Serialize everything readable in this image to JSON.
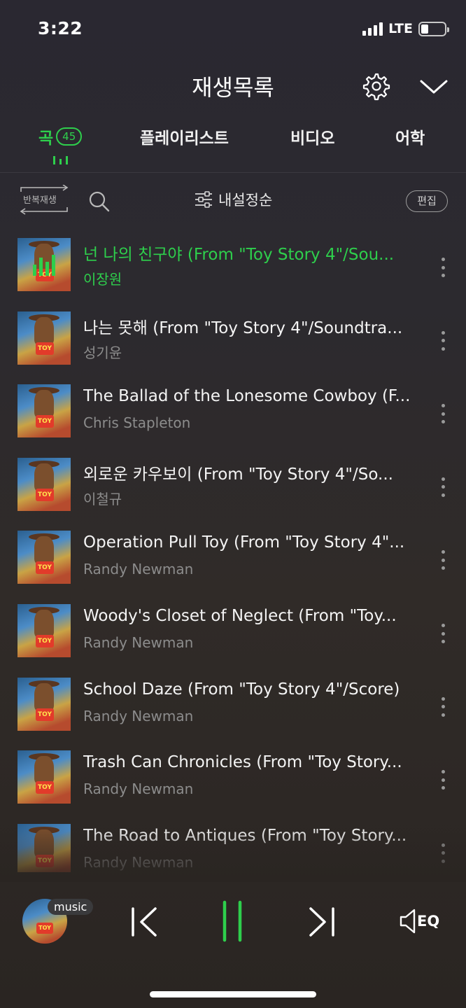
{
  "status_bar": {
    "time": "3:22",
    "network": "LTE"
  },
  "header": {
    "title": "재생목록"
  },
  "tabs": [
    {
      "label": "곡",
      "count": "45",
      "active": true
    },
    {
      "label": "플레이리스트"
    },
    {
      "label": "비디오"
    },
    {
      "label": "어학"
    }
  ],
  "toolbar": {
    "repeat_label": "반복재생",
    "sort_label": "내설정순",
    "edit_label": "편집"
  },
  "songs": [
    {
      "title": "넌 나의 친구야 (From \"Toy Story 4\"/Sou...",
      "artist": "이장원",
      "playing": true
    },
    {
      "title": "나는 못해 (From \"Toy Story 4\"/Soundtra...",
      "artist": "성기윤"
    },
    {
      "title": "The Ballad of the Lonesome Cowboy (F...",
      "artist": "Chris Stapleton"
    },
    {
      "title": "외로운 카우보이 (From \"Toy Story 4\"/So...",
      "artist": "이철규"
    },
    {
      "title": "Operation Pull Toy (From \"Toy Story 4\"...",
      "artist": "Randy Newman"
    },
    {
      "title": "Woody's Closet of Neglect (From \"Toy...",
      "artist": "Randy Newman"
    },
    {
      "title": "School Daze (From \"Toy Story 4\"/Score)",
      "artist": "Randy Newman"
    },
    {
      "title": "Trash Can Chronicles (From \"Toy Story...",
      "artist": "Randy Newman"
    },
    {
      "title": "The Road to Antiques (From \"Toy Story...",
      "artist": "Randy Newman"
    }
  ],
  "player": {
    "source_badge": "music",
    "eq_label": "EQ",
    "state": "playing"
  },
  "colors": {
    "accent": "#2ecf4c",
    "background": "#2b2830",
    "secondary_text": "#8c8c8c"
  }
}
